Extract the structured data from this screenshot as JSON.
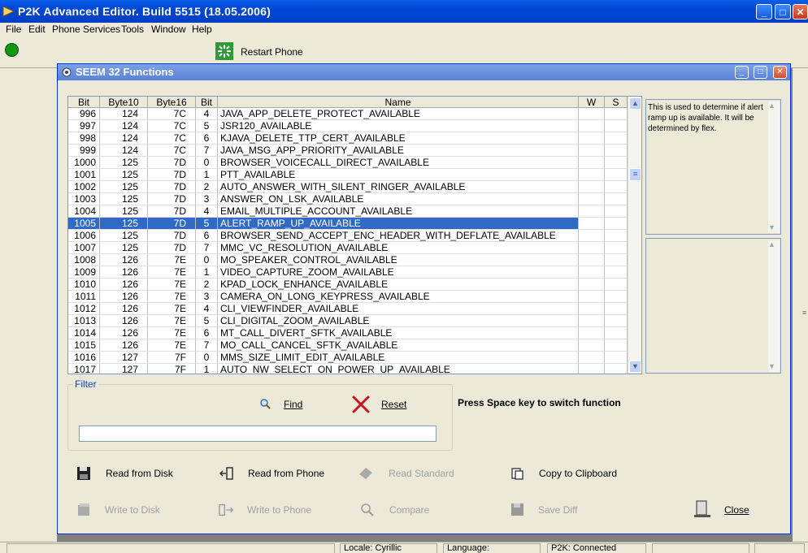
{
  "window": {
    "title": "P2K Advanced Editor. Build 5515 (18.05.2006)"
  },
  "menu": [
    "File",
    "Edit",
    "Phone Services",
    "Tools",
    "Window",
    "Help"
  ],
  "toolbar": {
    "restart_label": "Restart Phone",
    "indicator_color": "#119911"
  },
  "child": {
    "title": "SEEM 32 Functions"
  },
  "grid": {
    "headers": {
      "bit": "Bit",
      "byte10": "Byte10",
      "byte16": "Byte16",
      "bbit": "Bit",
      "name": "Name",
      "w": "W",
      "s": "S"
    },
    "rows": [
      [
        "996",
        "124",
        "7C",
        "4",
        "JAVA_APP_DELETE_PROTECT_AVAILABLE"
      ],
      [
        "997",
        "124",
        "7C",
        "5",
        "JSR120_AVAILABLE"
      ],
      [
        "998",
        "124",
        "7C",
        "6",
        "KJAVA_DELETE_TTP_CERT_AVAILABLE"
      ],
      [
        "999",
        "124",
        "7C",
        "7",
        "JAVA_MSG_APP_PRIORITY_AVAILABLE"
      ],
      [
        "1000",
        "125",
        "7D",
        "0",
        "BROWSER_VOICECALL_DIRECT_AVAILABLE"
      ],
      [
        "1001",
        "125",
        "7D",
        "1",
        "PTT_AVAILABLE"
      ],
      [
        "1002",
        "125",
        "7D",
        "2",
        "AUTO_ANSWER_WITH_SILENT_RINGER_AVAILABLE"
      ],
      [
        "1003",
        "125",
        "7D",
        "3",
        "ANSWER_ON_LSK_AVAILABLE"
      ],
      [
        "1004",
        "125",
        "7D",
        "4",
        "EMAIL_MULTIPLE_ACCOUNT_AVAILABLE"
      ],
      [
        "1005",
        "125",
        "7D",
        "5",
        "ALERT_RAMP_UP_AVAILABLE"
      ],
      [
        "1006",
        "125",
        "7D",
        "6",
        "BROWSER_SEND_ACCEPT_ENC_HEADER_WITH_DEFLATE_AVAILABLE"
      ],
      [
        "1007",
        "125",
        "7D",
        "7",
        "MMC_VC_RESOLUTION_AVAILABLE"
      ],
      [
        "1008",
        "126",
        "7E",
        "0",
        "MO_SPEAKER_CONTROL_AVAILABLE"
      ],
      [
        "1009",
        "126",
        "7E",
        "1",
        "VIDEO_CAPTURE_ZOOM_AVAILABLE"
      ],
      [
        "1010",
        "126",
        "7E",
        "2",
        "KPAD_LOCK_ENHANCE_AVAILABLE"
      ],
      [
        "1011",
        "126",
        "7E",
        "3",
        "CAMERA_ON_LONG_KEYPRESS_AVAILABLE"
      ],
      [
        "1012",
        "126",
        "7E",
        "4",
        "CLI_VIEWFINDER_AVAILABLE"
      ],
      [
        "1013",
        "126",
        "7E",
        "5",
        "CLI_DIGITAL_ZOOM_AVAILABLE"
      ],
      [
        "1014",
        "126",
        "7E",
        "6",
        "MT_CALL_DIVERT_SFTK_AVAILABLE"
      ],
      [
        "1015",
        "126",
        "7E",
        "7",
        "MO_CALL_CANCEL_SFTK_AVAILABLE"
      ],
      [
        "1016",
        "127",
        "7F",
        "0",
        "MMS_SIZE_LIMIT_EDIT_AVAILABLE"
      ],
      [
        "1017",
        "127",
        "7F",
        "1",
        "AUTO_NW_SELECT_ON_POWER_UP_AVAILABLE"
      ]
    ],
    "selected_index": 9,
    "selection_color": "#316ac5"
  },
  "description": "This is used to determine if alert ramp up is available. It will be determined by flex.",
  "filter": {
    "legend": "Filter",
    "find_label": "Find",
    "reset_label": "Reset",
    "hint": "Press Space key to switch function"
  },
  "actions": {
    "read_disk": "Read from Disk",
    "read_phone": "Read from Phone",
    "read_standard": "Read Standard",
    "copy_clipboard": "Copy to Clipboard",
    "write_disk": "Write to Disk",
    "write_phone": "Write to Phone",
    "compare": "Compare",
    "save_diff": "Save Diff",
    "close": "Close"
  },
  "status": {
    "locale": "Locale: Cyrillic",
    "language": "Language:",
    "connection": "P2K: Connected"
  }
}
